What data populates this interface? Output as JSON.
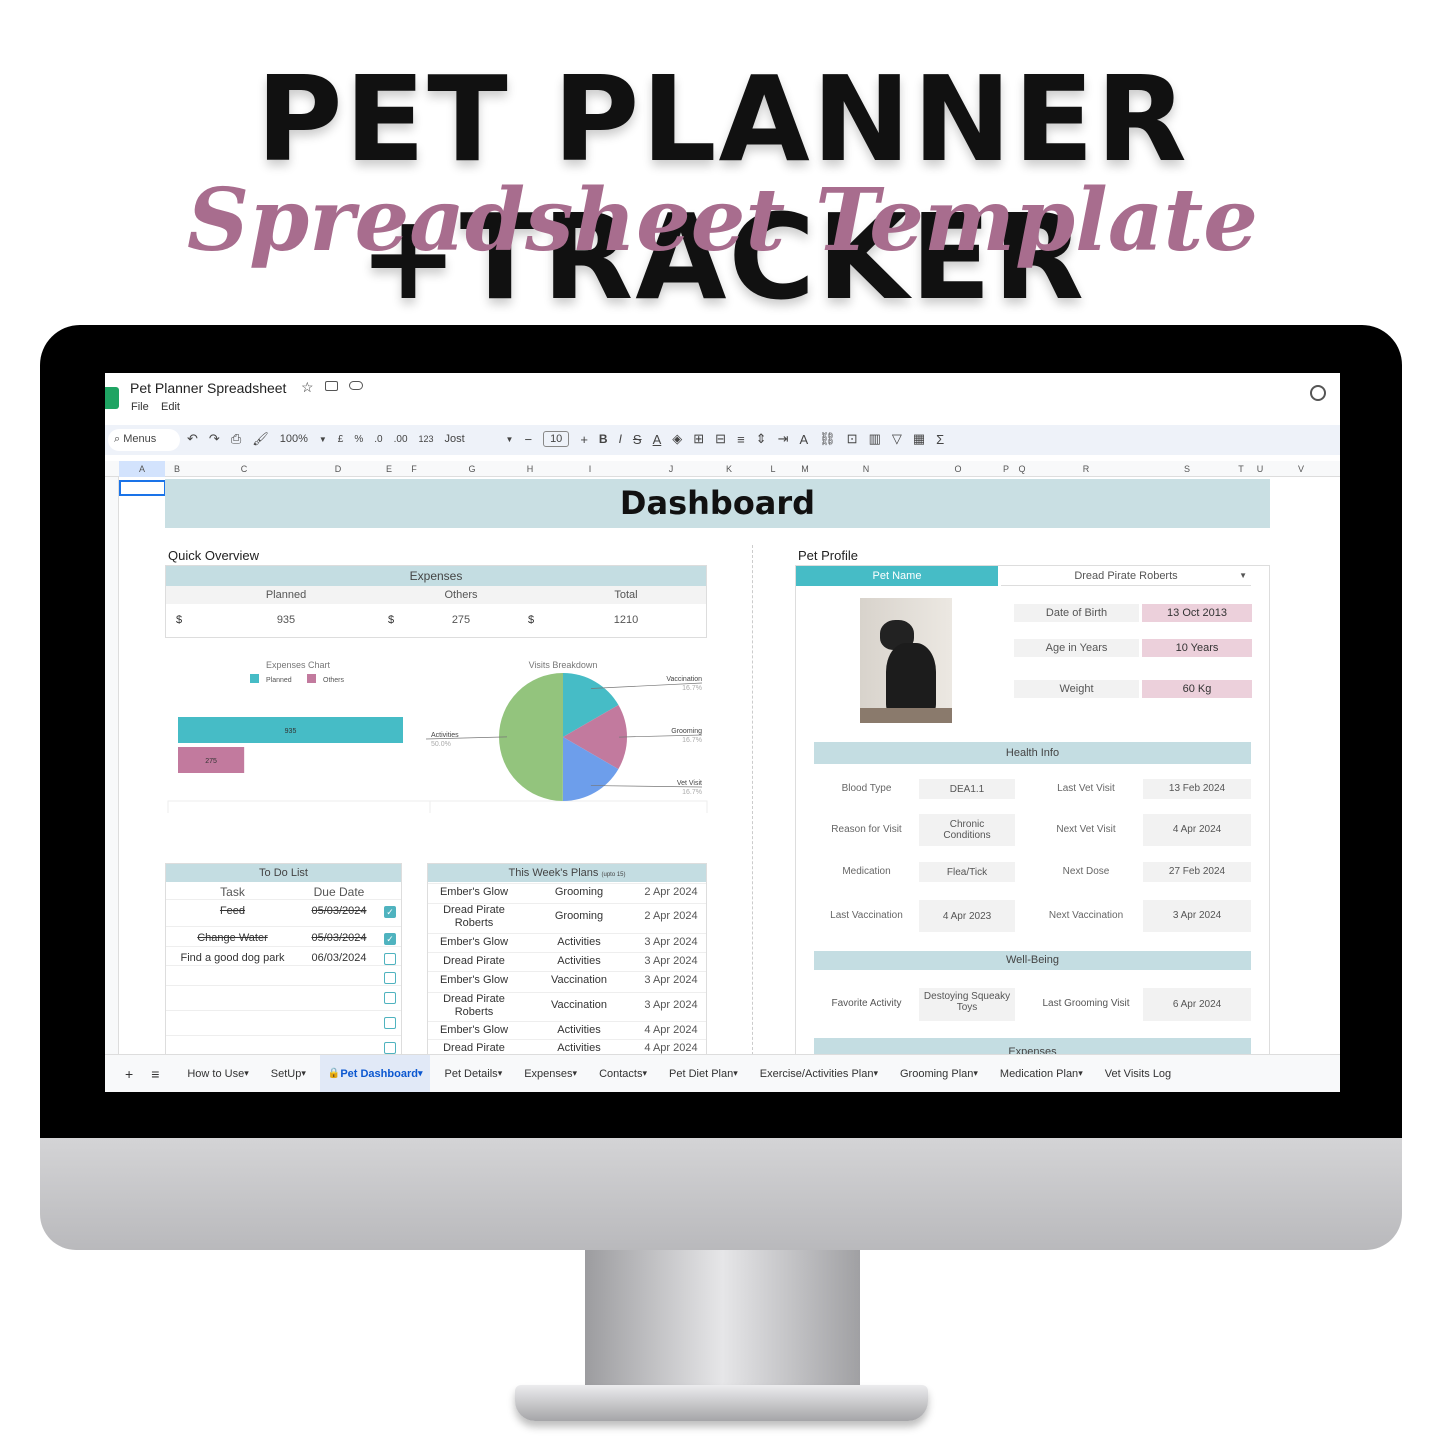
{
  "hero": {
    "title": "PET PLANNER +TRACKER",
    "subtitle": "Spreadsheet Template"
  },
  "app": {
    "doc_title": "Pet Planner Spreadsheet",
    "menus": [
      "File",
      "Edit"
    ],
    "toolbar": {
      "search": "Menus",
      "zoom": "100%",
      "currency": "£",
      "percent": "%",
      "dec_less": ".0",
      "dec_more": ".00",
      "format": "123",
      "font": "Jost",
      "font_size": "10",
      "bold": "B",
      "italic": "I"
    },
    "columns": [
      "A",
      "B",
      "C",
      "D",
      "E",
      "F",
      "G",
      "H",
      "I",
      "J",
      "K",
      "L",
      "M",
      "N",
      "O",
      "P",
      "Q",
      "R",
      "S",
      "T",
      "U",
      "V"
    ]
  },
  "sheet": {
    "title": "Dashboard",
    "quick_overview": {
      "label": "Quick Overview",
      "expenses_header": "Expenses",
      "cols": [
        "Planned",
        "Others",
        "Total"
      ],
      "currency": "$",
      "values": [
        "935",
        "275",
        "1210"
      ]
    },
    "pet_profile": {
      "label": "Pet Profile",
      "name_label": "Pet Name",
      "name_value": "Dread Pirate Roberts",
      "fields": [
        {
          "label": "Date of Birth",
          "value": "13 Oct 2013"
        },
        {
          "label": "Age in Years",
          "value": "10 Years"
        },
        {
          "label": "Weight",
          "value": "60 Kg"
        }
      ]
    },
    "health": {
      "header": "Health Info",
      "rows": [
        {
          "l1": "Blood Type",
          "v1": "DEA1.1",
          "l2": "Last Vet Visit",
          "v2": "13 Feb 2024"
        },
        {
          "l1": "Reason for Visit",
          "v1": "Chronic Conditions",
          "l2": "Next Vet Visit",
          "v2": "4 Apr 2024"
        },
        {
          "l1": "Medication",
          "v1": "Flea/Tick",
          "l2": "Next Dose",
          "v2": "27 Feb 2024"
        },
        {
          "l1": "Last Vaccination",
          "v1": "4 Apr 2023",
          "l2": "Next Vaccination",
          "v2": "3 Apr 2024"
        }
      ]
    },
    "wellbeing": {
      "header": "Well-Being",
      "l1": "Favorite Activity",
      "v1": "Destoying Squeaky Toys",
      "l2": "Last Grooming Visit",
      "v2": "6 Apr 2024"
    },
    "expenses_section": {
      "header": "Expenses"
    },
    "todo": {
      "header": "To Do List",
      "cols": [
        "Task",
        "Due Date"
      ],
      "rows": [
        {
          "task": "Feed",
          "date": "05/03/2024",
          "done": true
        },
        {
          "task": "Change Water",
          "date": "05/03/2024",
          "done": true
        },
        {
          "task": "Find a good dog park",
          "date": "06/03/2024",
          "done": false
        },
        {
          "task": "",
          "date": "",
          "done": false
        },
        {
          "task": "",
          "date": "",
          "done": false
        },
        {
          "task": "",
          "date": "",
          "done": false
        },
        {
          "task": "",
          "date": "",
          "done": false
        }
      ]
    },
    "plans": {
      "header": "This Week's Plans",
      "note": "(upto 15)",
      "rows": [
        [
          "Ember's Glow",
          "Grooming",
          "2 Apr 2024"
        ],
        [
          "Dread Pirate Roberts",
          "Grooming",
          "2 Apr 2024"
        ],
        [
          "Ember's Glow",
          "Activities",
          "3 Apr 2024"
        ],
        [
          "Dread Pirate",
          "Activities",
          "3 Apr 2024"
        ],
        [
          "Ember's Glow",
          "Vaccination",
          "3 Apr 2024"
        ],
        [
          "Dread Pirate Roberts",
          "Vaccination",
          "3 Apr 2024"
        ],
        [
          "Ember's Glow",
          "Activities",
          "4 Apr 2024"
        ],
        [
          "Dread Pirate",
          "Activities",
          "4 Apr 2024"
        ]
      ]
    }
  },
  "chart_data": [
    {
      "type": "bar",
      "title": "Expenses Chart",
      "orientation": "horizontal",
      "legend": "top",
      "series": [
        {
          "name": "Planned",
          "values": [
            935
          ],
          "color": "#46bcc6"
        },
        {
          "name": "Others",
          "values": [
            275
          ],
          "color": "#c27a9e"
        }
      ]
    },
    {
      "type": "pie",
      "title": "Visits Breakdown",
      "slices": [
        {
          "label": "Vaccination",
          "value": 16.7,
          "text": "16.7%",
          "color": "#46bcc6"
        },
        {
          "label": "Grooming",
          "value": 16.7,
          "text": "16.7%",
          "color": "#c27a9e"
        },
        {
          "label": "Vet Visit",
          "value": 16.7,
          "text": "16.7%",
          "color": "#6d9eeb"
        },
        {
          "label": "Activities",
          "value": 50.0,
          "text": "50.0%",
          "color": "#93c47d"
        }
      ]
    }
  ],
  "tabs": [
    "How to Use",
    "SetUp",
    "Pet Dashboard",
    "Pet Details",
    "Expenses",
    "Contacts",
    "Pet Diet Plan",
    "Exercise/Activities Plan",
    "Grooming Plan",
    "Medication Plan",
    "Vet Visits Log"
  ],
  "active_tab": "Pet Dashboard"
}
